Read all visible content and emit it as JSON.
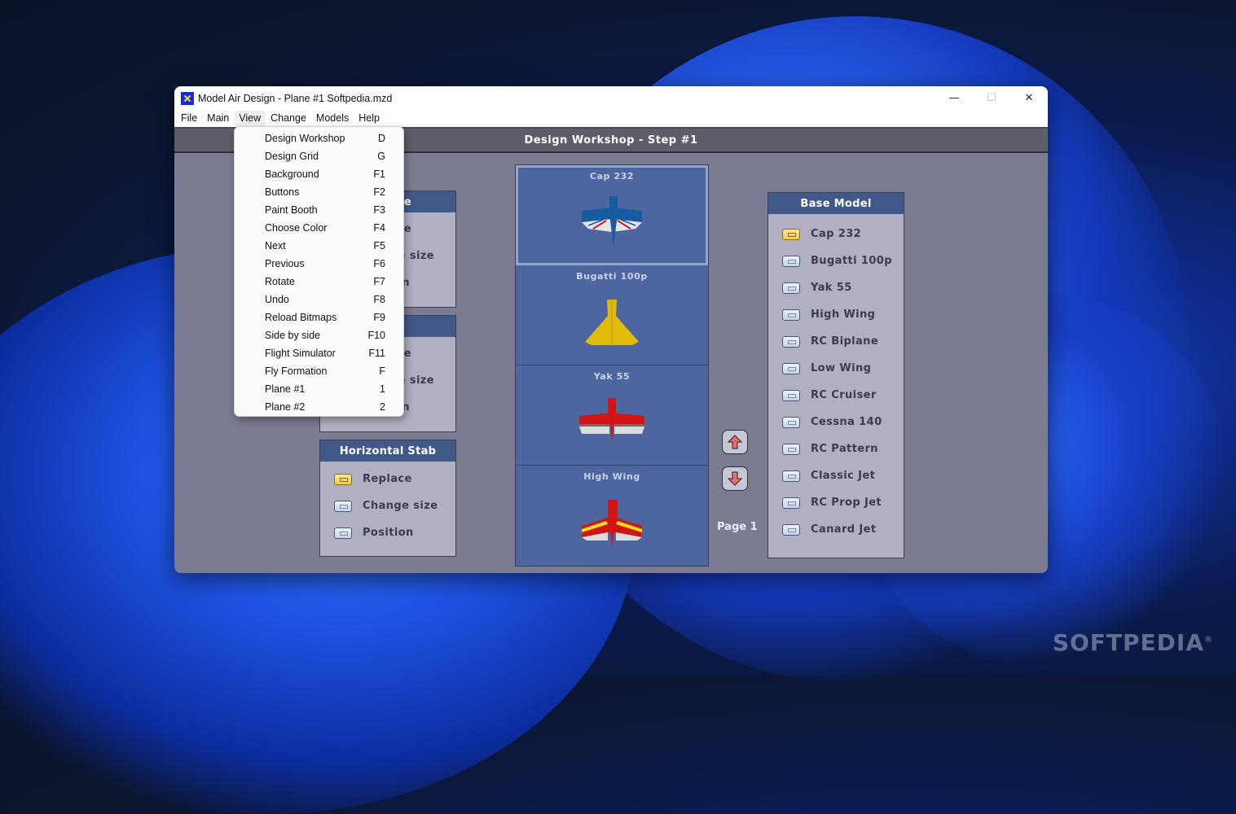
{
  "window": {
    "title": "Model Air Design - Plane #1  Softpedia.mzd",
    "controls": {
      "minimize": "—",
      "maximize": "☐",
      "close": "✕"
    }
  },
  "menubar": [
    "File",
    "Main",
    "View",
    "Change",
    "Models",
    "Help"
  ],
  "view_menu": [
    {
      "label": "Design Workshop",
      "shortcut": "D"
    },
    {
      "label": "Design Grid",
      "shortcut": "G"
    },
    {
      "label": "Background",
      "shortcut": "F1"
    },
    {
      "label": "Buttons",
      "shortcut": "F2"
    },
    {
      "label": "Paint Booth",
      "shortcut": "F3"
    },
    {
      "label": "Choose Color",
      "shortcut": "F4"
    },
    {
      "label": "Next",
      "shortcut": "F5"
    },
    {
      "label": "Previous",
      "shortcut": "F6"
    },
    {
      "label": "Rotate",
      "shortcut": "F7"
    },
    {
      "label": "Undo",
      "shortcut": "F8"
    },
    {
      "label": "Reload Bitmaps",
      "shortcut": "F9"
    },
    {
      "label": "Side by side",
      "shortcut": "F10"
    },
    {
      "label": "Flight Simulator",
      "shortcut": "F11"
    },
    {
      "label": "Fly Formation",
      "shortcut": "F"
    },
    {
      "label": "Plane #1",
      "shortcut": "1"
    },
    {
      "label": "Plane #2",
      "shortcut": "2"
    }
  ],
  "step_title": "Design Workshop  -  Step #1",
  "panel1": {
    "title": "e",
    "options": [
      "e",
      "e size",
      "n"
    ]
  },
  "panel2": {
    "title": "",
    "options": [
      "e",
      "e size",
      "n"
    ]
  },
  "horizontal_stab": {
    "title": "Horizontal Stab",
    "options": [
      {
        "label": "Replace",
        "selected": true
      },
      {
        "label": "Change size",
        "selected": false
      },
      {
        "label": "Position",
        "selected": false
      }
    ]
  },
  "model_cards": [
    {
      "name": "Cap 232",
      "selected": true
    },
    {
      "name": "Bugatti 100p",
      "selected": false
    },
    {
      "name": "Yak 55",
      "selected": false
    },
    {
      "name": "High Wing",
      "selected": false
    }
  ],
  "page_label": "Page 1",
  "base_model": {
    "title": "Base Model",
    "options": [
      {
        "label": "Cap 232",
        "selected": true
      },
      {
        "label": "Bugatti 100p",
        "selected": false
      },
      {
        "label": "Yak 55",
        "selected": false
      },
      {
        "label": "High Wing",
        "selected": false
      },
      {
        "label": "RC Biplane",
        "selected": false
      },
      {
        "label": "Low Wing",
        "selected": false
      },
      {
        "label": "RC Cruiser",
        "selected": false
      },
      {
        "label": "Cessna 140",
        "selected": false
      },
      {
        "label": "RC Pattern",
        "selected": false
      },
      {
        "label": "Classic Jet",
        "selected": false
      },
      {
        "label": "RC Prop Jet",
        "selected": false
      },
      {
        "label": "Canard Jet",
        "selected": false
      }
    ]
  },
  "watermark": "SOFTPEDIA"
}
